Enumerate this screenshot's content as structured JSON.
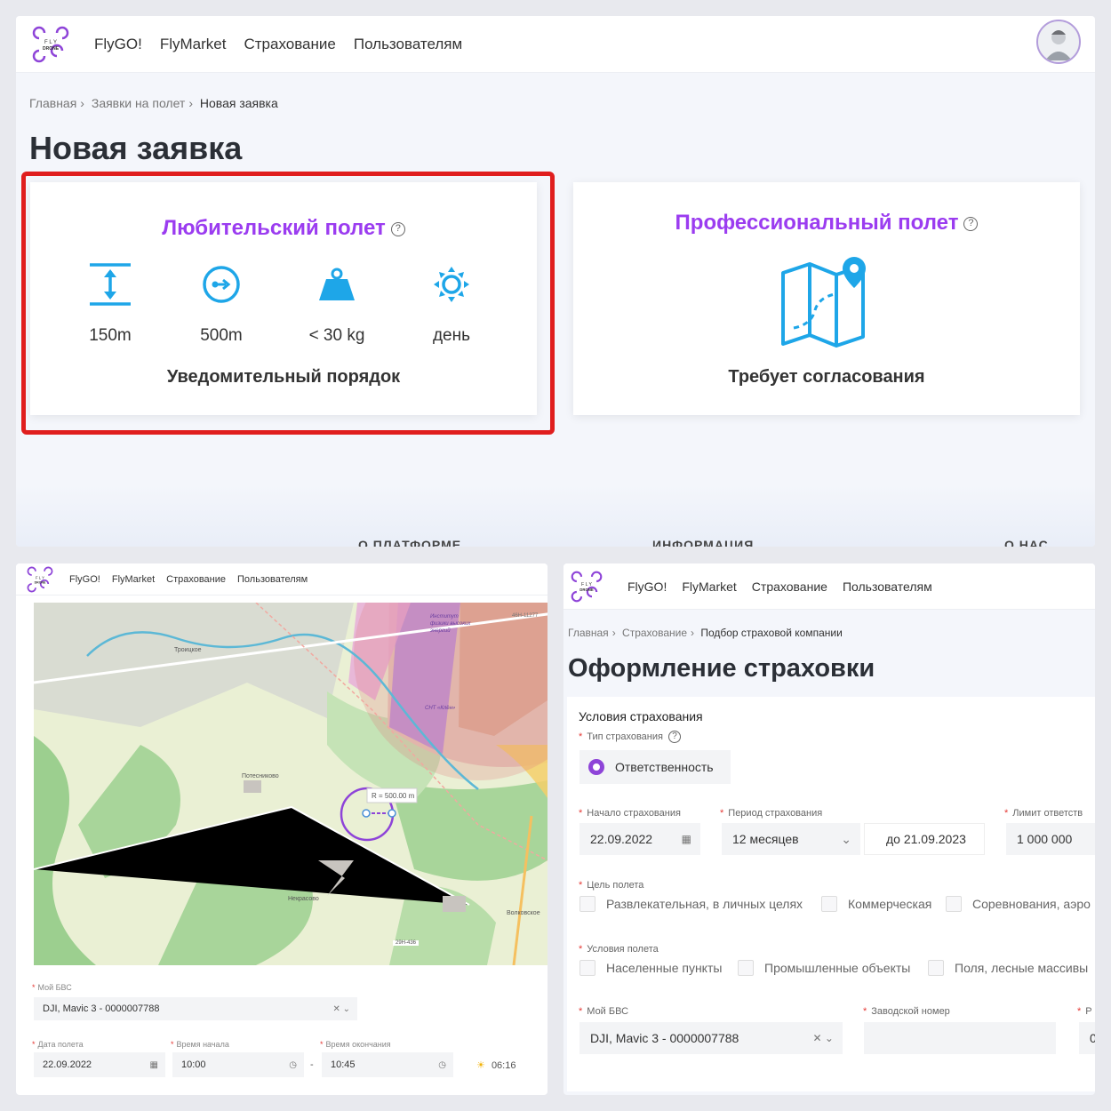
{
  "nav": {
    "items": [
      "FlyGO!",
      "FlyMarket",
      "Страхование",
      "Пользователям"
    ],
    "logo_text": [
      "F L Y",
      "DRONE"
    ]
  },
  "panel1": {
    "breadcrumbs": [
      "Главная",
      "Заявки на полет",
      "Новая заявка"
    ],
    "title": "Новая заявка",
    "amateur": {
      "title": "Любительский полет",
      "features": [
        {
          "icon": "altitude-icon",
          "label": "150m"
        },
        {
          "icon": "radius-icon",
          "label": "500m"
        },
        {
          "icon": "weight-icon",
          "label": "< 30 kg"
        },
        {
          "icon": "daylight-icon",
          "label": "день"
        }
      ],
      "order": "Уведомительный порядок"
    },
    "pro": {
      "title": "Профессиональный полет",
      "subtitle": "Требует согласования"
    },
    "footer_links": [
      "О ПЛАТФОРМЕ",
      "ИНФОРМАЦИЯ",
      "О НАС"
    ],
    "help_glyph": "?",
    "colors": {
      "accent": "#9b3cf0",
      "icon": "#1ea6e8",
      "highlight": "#e01e1e"
    }
  },
  "panel2": {
    "map": {
      "places": [
        "Троицкое",
        "Потесниково",
        "Некрасово",
        "Волковское"
      ],
      "roads": [
        "46Н-11277",
        "29Н-436"
      ],
      "institute": "Институт физики высоких энергий",
      "snt": "СНТ «Клён»",
      "radius_label": "R = 500.00 m"
    },
    "uav_label": "Мой БВС",
    "uav_value": "DJI, Mavic 3 - 0000007788",
    "date_label": "Дата полета",
    "date_value": "22.09.2022",
    "start_label": "Время начала",
    "start_value": "10:00",
    "end_label": "Время окончания",
    "end_value": "10:45",
    "dash": "-",
    "sunrise": "06:16"
  },
  "panel3": {
    "breadcrumbs": [
      "Главная",
      "Страхование",
      "Подбор страховой компании"
    ],
    "title": "Оформление страховки",
    "section": "Условия страхования",
    "type_label": "Тип страхования",
    "type_value": "Ответственность",
    "start_label": "Начало страхования",
    "start_value": "22.09.2022",
    "period_label": "Период страхования",
    "period_value": "12 месяцев",
    "until_value": "до 21.09.2023",
    "limit_label": "Лимит ответств",
    "limit_value": "1 000 000",
    "purpose_label": "Цель полета",
    "purpose_options": [
      "Развлекательная, в личных целях",
      "Коммерческая",
      "Соревнования, аэро"
    ],
    "conditions_label": "Условия полета",
    "conditions_options": [
      "Населенные пункты",
      "Промышленные объекты",
      "Поля, лесные массивы"
    ],
    "uav_label": "Мой БВС",
    "uav_value": "DJI, Mavic 3 - 0000007788",
    "serial_label": "Заводской номер",
    "extra_label": "Р",
    "extra_value": "0"
  }
}
